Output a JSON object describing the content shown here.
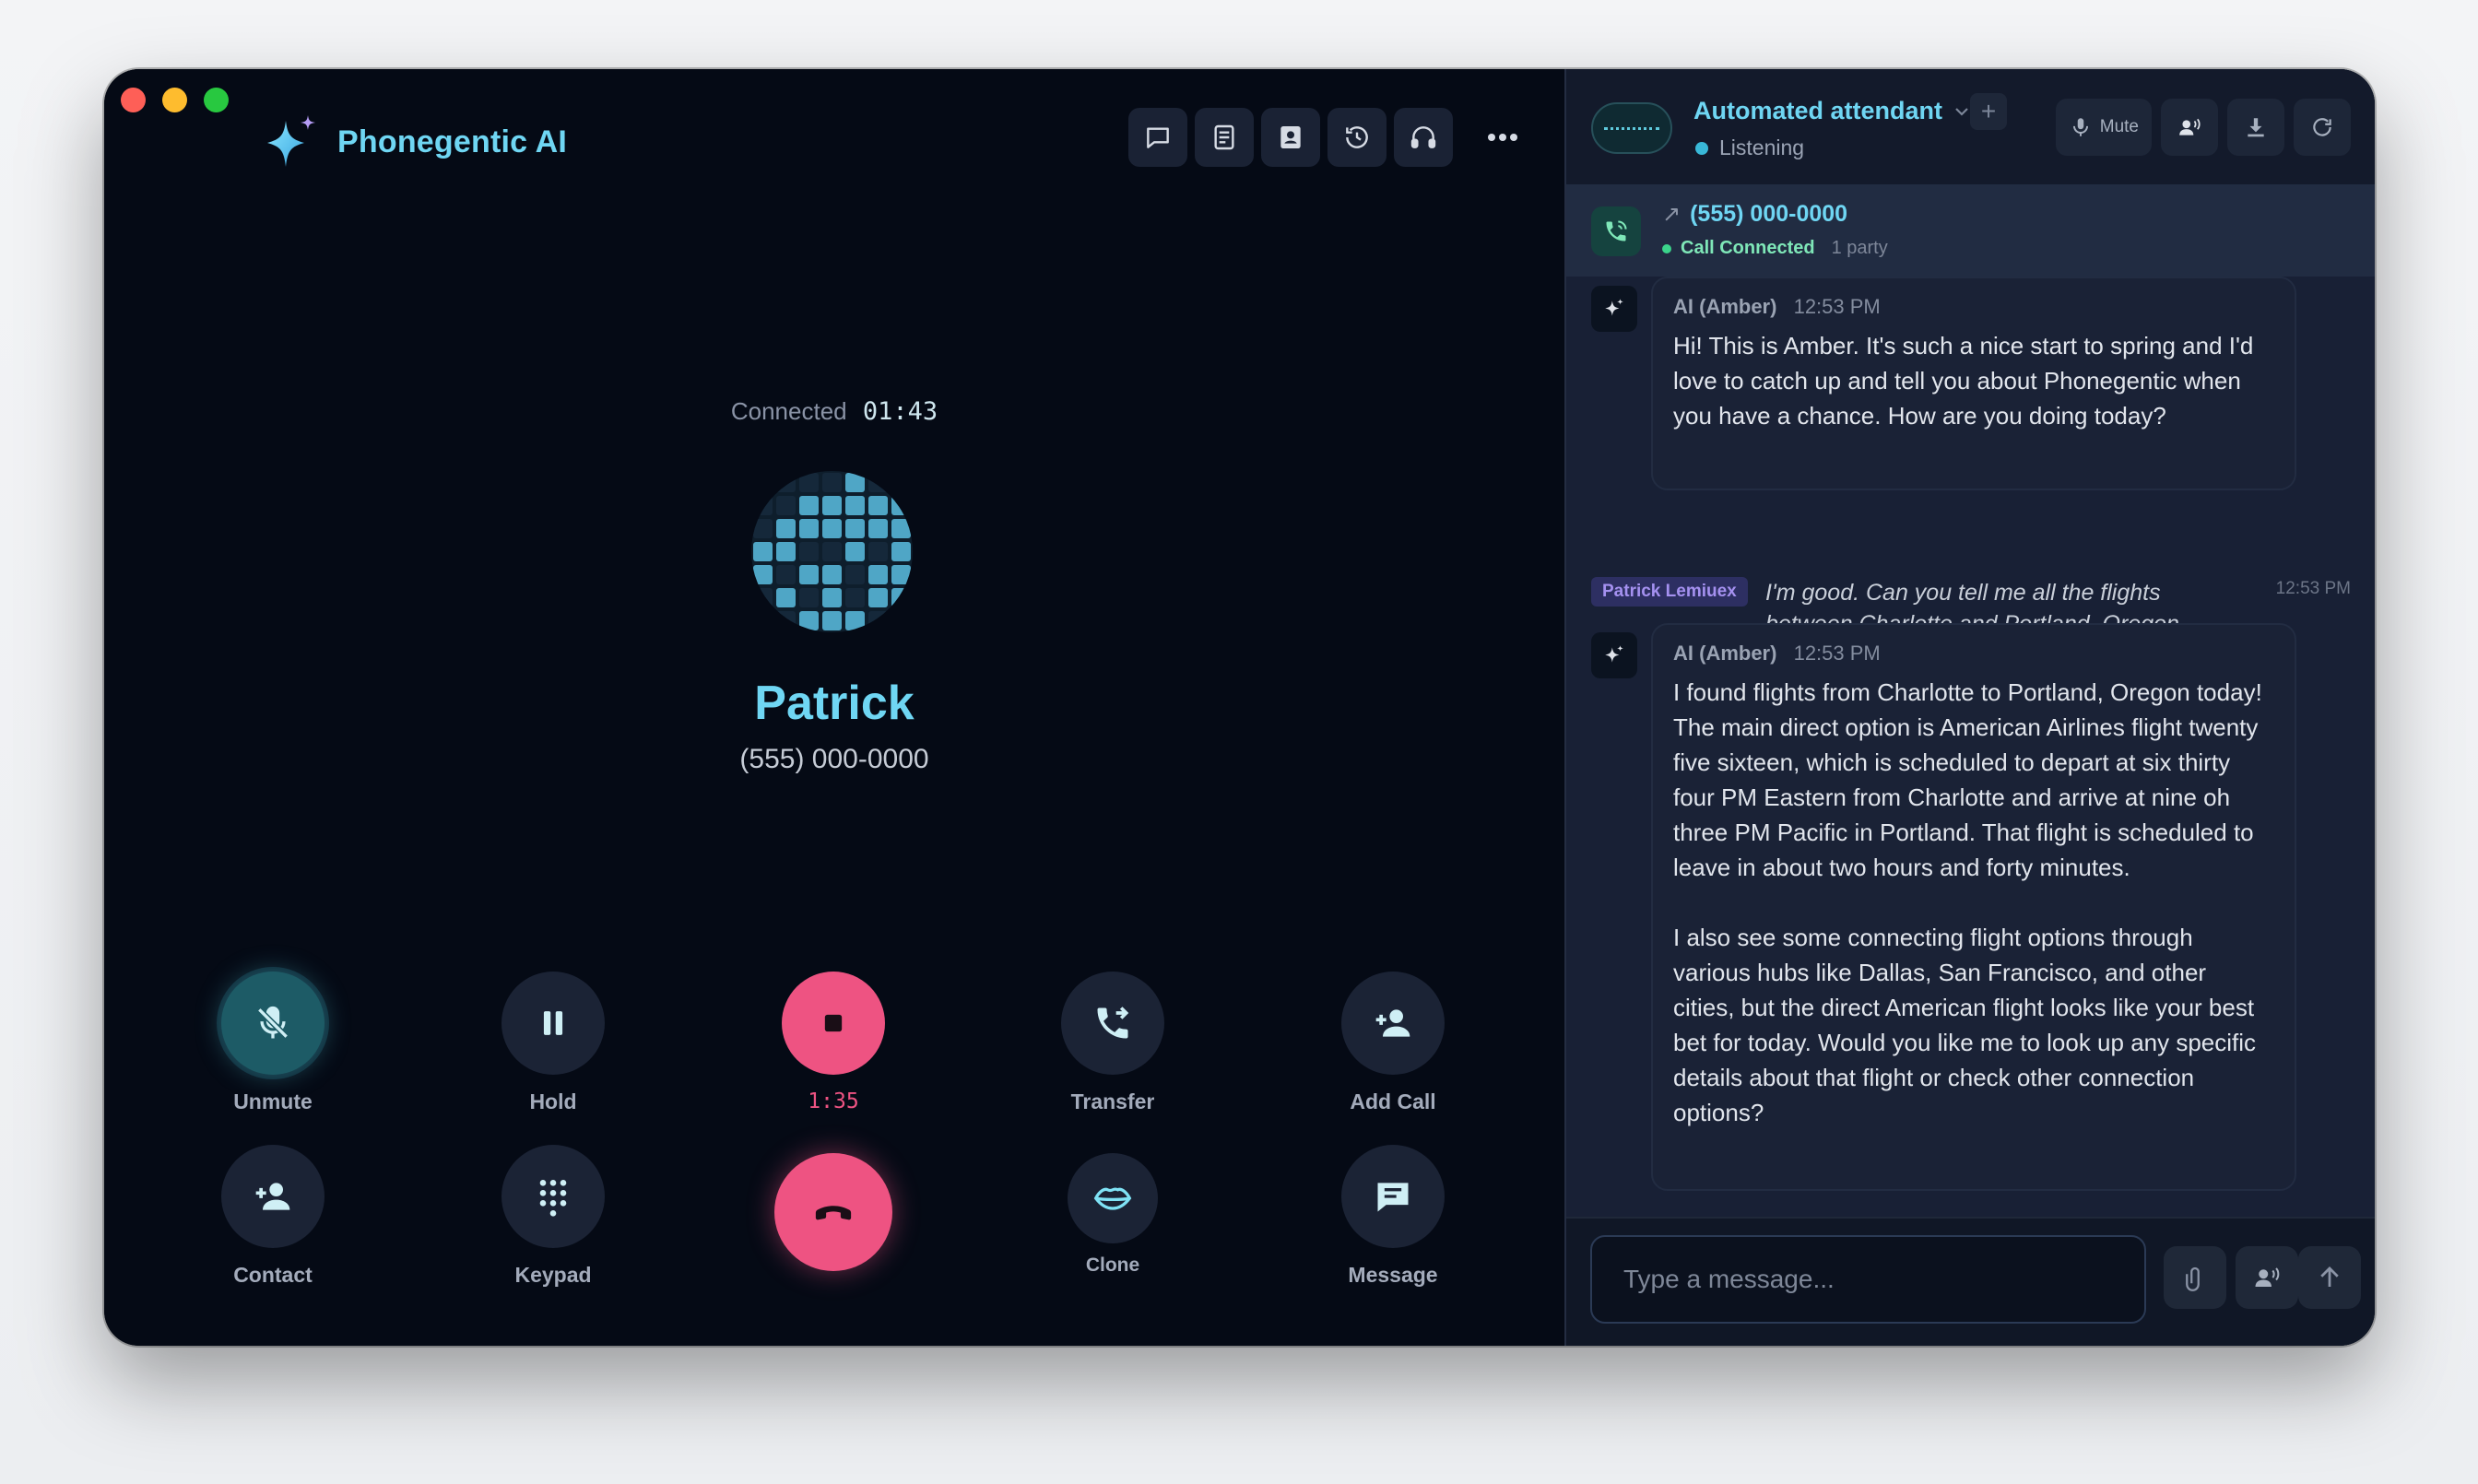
{
  "window": {
    "traffic_lights": [
      "close",
      "minimize",
      "zoom"
    ]
  },
  "brand": {
    "name": "Phonegentic AI",
    "icon": "sparkle-icon"
  },
  "toolbar": {
    "buttons": [
      "chat-icon",
      "transcript-icon",
      "contacts-icon",
      "history-icon",
      "headset-icon"
    ],
    "more": "more-icon"
  },
  "call": {
    "status_label": "Connected",
    "elapsed": "01:43",
    "caller_name": "Patrick",
    "caller_number": "(555) 000-0000"
  },
  "controls": {
    "row1": [
      {
        "label": "Unmute",
        "icon": "mic-off-icon"
      },
      {
        "label": "Hold",
        "icon": "pause-icon"
      },
      {
        "label": "1:35",
        "icon": "stop-icon"
      },
      {
        "label": "Transfer",
        "icon": "transfer-icon"
      },
      {
        "label": "Add Call",
        "icon": "add-person-icon"
      }
    ],
    "row2": [
      {
        "label": "Contact",
        "icon": "contact-icon"
      },
      {
        "label": "Keypad",
        "icon": "keypad-icon"
      },
      {
        "label": "",
        "icon": "hang-up-icon"
      },
      {
        "label": "Clone",
        "icon": "lips-icon"
      },
      {
        "label": "Message",
        "icon": "message-icon"
      }
    ]
  },
  "agent": {
    "name": "Automated attendant",
    "status": "Listening",
    "mute_label": "Mute"
  },
  "banner": {
    "number": "(555) 000-0000",
    "status": "Call Connected",
    "party": "1 party"
  },
  "messages": [
    {
      "sender": "AI (Amber)",
      "time": "12:53 PM",
      "text": "Hi! This is Amber. It's such a nice start to spring and I'd love to catch up and tell you about Phonegentic when you have a chance. How are you doing today?"
    },
    {
      "sender": "Patrick Lemiuex",
      "time": "12:53 PM",
      "text": "I'm good. Can you tell me all the flights between Charlotte and Portland, Oregon today?"
    },
    {
      "sender": "AI (Amber)",
      "time": "12:53 PM",
      "text": "I found flights from Charlotte to Portland, Oregon today! The main direct option is American Airlines flight twenty five sixteen, which is scheduled to depart at six thirty four PM Eastern from Charlotte and arrive at nine oh three PM Pacific in Portland. That flight is scheduled to leave in about two hours and forty minutes.\n\nI also see some connecting flight options through various hubs like Dallas, San Francisco, and other cities, but the direct American flight looks like your best bet for today. Would you like me to look up any specific details about that flight or check other connection options?"
    }
  ],
  "composer": {
    "placeholder": "Type a message..."
  },
  "colors": {
    "accent": "#6fd6f3",
    "danger": "#ee5382",
    "success": "#3bd48b",
    "background": "#050a15",
    "panel": "#182035"
  }
}
